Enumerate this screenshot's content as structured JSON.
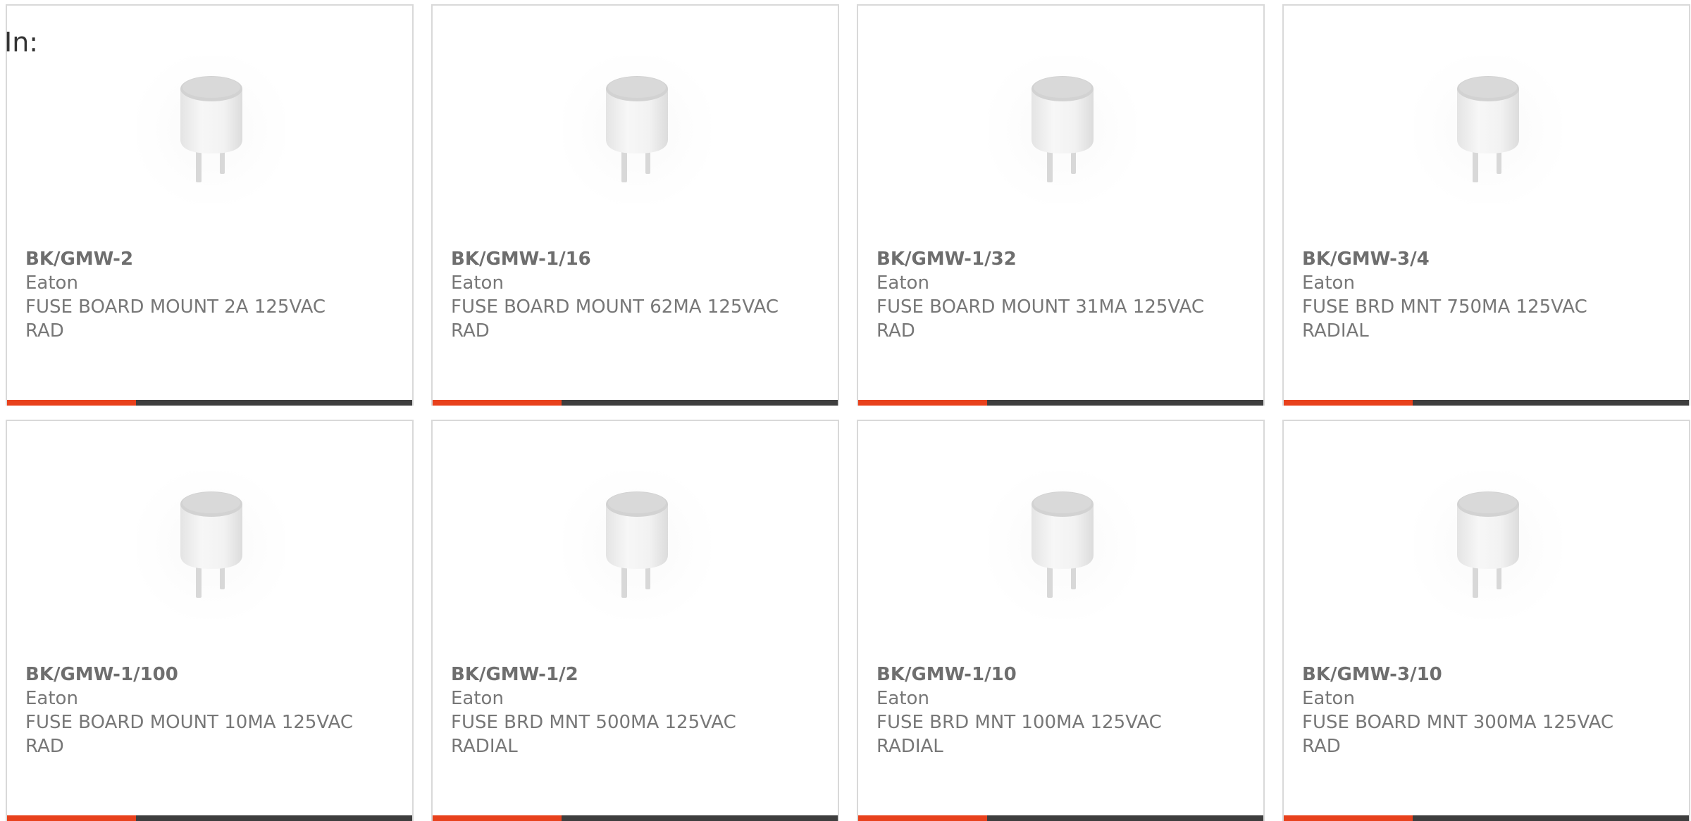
{
  "heading": "In:",
  "colors": {
    "accent": "#e8411c",
    "bar": "#3e3e3e",
    "border": "#d9d9d9",
    "text": "#777777"
  },
  "products": [
    {
      "part": "BK/GMW-2",
      "manufacturer": "Eaton",
      "description": "FUSE BOARD MOUNT 2A 125VAC RAD",
      "image_icon": "fuse-product-image"
    },
    {
      "part": "BK/GMW-1/16",
      "manufacturer": "Eaton",
      "description": "FUSE BOARD MOUNT 62MA 125VAC RAD",
      "image_icon": "fuse-product-image"
    },
    {
      "part": "BK/GMW-1/32",
      "manufacturer": "Eaton",
      "description": "FUSE BOARD MOUNT 31MA 125VAC RAD",
      "image_icon": "fuse-product-image"
    },
    {
      "part": "BK/GMW-3/4",
      "manufacturer": "Eaton",
      "description": "FUSE BRD MNT 750MA 125VAC RADIAL",
      "image_icon": "fuse-product-image"
    },
    {
      "part": "BK/GMW-1/100",
      "manufacturer": "Eaton",
      "description": "FUSE BOARD MOUNT 10MA 125VAC RAD",
      "image_icon": "fuse-product-image"
    },
    {
      "part": "BK/GMW-1/2",
      "manufacturer": "Eaton",
      "description": "FUSE BRD MNT 500MA 125VAC RADIAL",
      "image_icon": "fuse-product-image"
    },
    {
      "part": "BK/GMW-1/10",
      "manufacturer": "Eaton",
      "description": "FUSE BRD MNT 100MA 125VAC RADIAL",
      "image_icon": "fuse-product-image"
    },
    {
      "part": "BK/GMW-3/10",
      "manufacturer": "Eaton",
      "description": "FUSE BOARD MNT 300MA 125VAC RAD",
      "image_icon": "fuse-product-image"
    }
  ]
}
